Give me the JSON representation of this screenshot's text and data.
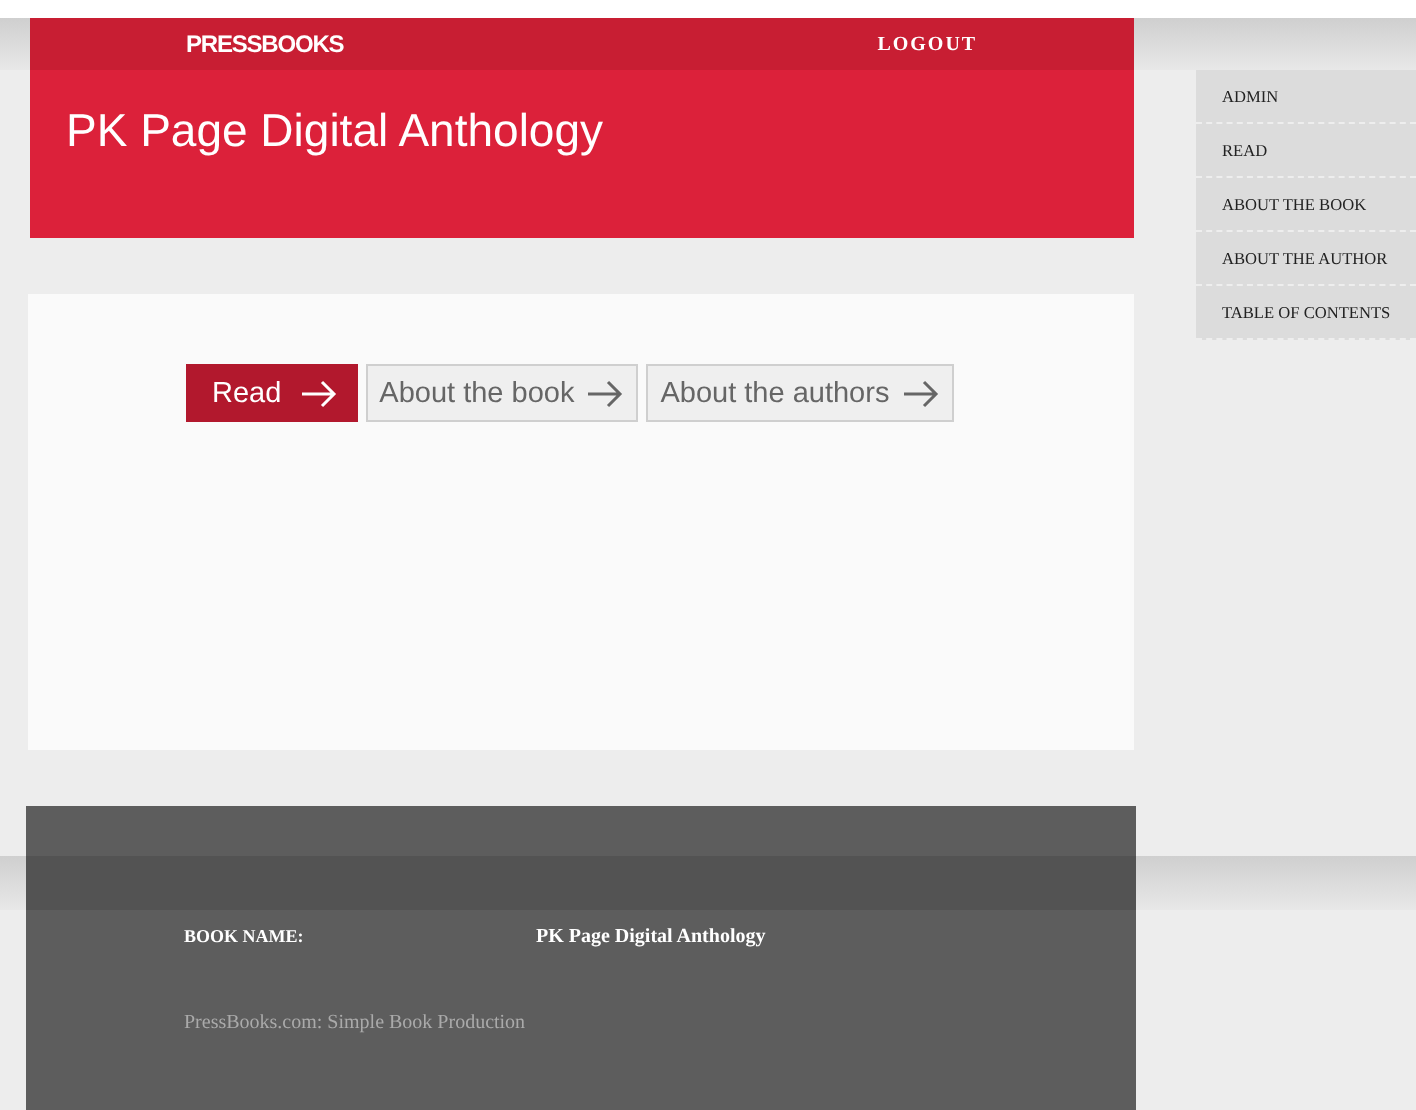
{
  "topbar": {
    "logo": "PRESSBOOKS",
    "logout": "LOGOUT"
  },
  "header": {
    "title": "PK Page Digital Anthology"
  },
  "buttons": [
    {
      "label": "Read",
      "kind": "primary"
    },
    {
      "label": "About the book",
      "kind": "secondary"
    },
    {
      "label": "About the authors",
      "kind": "secondary"
    }
  ],
  "sidebar": {
    "items": [
      {
        "label": "ADMIN"
      },
      {
        "label": "READ"
      },
      {
        "label": "ABOUT THE BOOK"
      },
      {
        "label": "ABOUT THE AUTHOR"
      },
      {
        "label": "TABLE OF CONTENTS"
      }
    ]
  },
  "footer": {
    "book_name_label": "BOOK NAME:",
    "book_name": "PK Page Digital Anthology",
    "tagline": "PressBooks.com: Simple Book Production"
  }
}
